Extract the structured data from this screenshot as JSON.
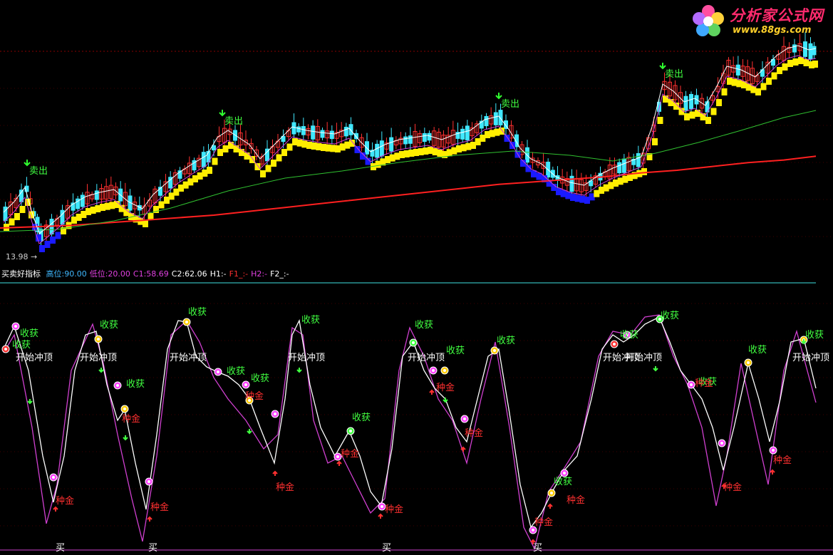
{
  "brand": {
    "title": "分析家公式网",
    "url": "www.88gs.com"
  },
  "price_panel": {
    "low_marker": "13.98",
    "sell_label": "卖出"
  },
  "indicator_bar": {
    "name": "买卖好指标",
    "items": [
      {
        "text": "高位:90.00",
        "color": "#3fb8ff"
      },
      {
        "text": "低位:20.00",
        "color": "#e040e0"
      },
      {
        "text": "C1:58.69",
        "color": "#e040e0"
      },
      {
        "text": "C2:62.06",
        "color": "#ffffff"
      },
      {
        "text": "H1:-",
        "color": "#ffffff"
      },
      {
        "text": "F1_:-",
        "color": "#ff3030"
      },
      {
        "text": "H2:-",
        "color": "#e040e0"
      },
      {
        "text": "F2_:-",
        "color": "#ffffff"
      }
    ]
  },
  "labels": {
    "harvest": "收获",
    "start_top": "开始冲顶",
    "plant_gold": "种金",
    "buy": "买"
  },
  "colors": {
    "ma_long": "#ff2020",
    "ma_mid": "#30c030",
    "ma_fast": "#d040d0",
    "ribbon_up": "#ffee00",
    "ribbon_down": "#1a1aff",
    "osc_fast": "#ffffff",
    "osc_slow": "#d040d0"
  },
  "chart_data": [
    {
      "type": "line",
      "title": "",
      "series": [
        {
          "name": "",
          "x": [
            0,
            50,
            100,
            150,
            200,
            250,
            300,
            350,
            400,
            450,
            500,
            550,
            600,
            650,
            700,
            750,
            800,
            850,
            900,
            950,
            1000,
            1050,
            1100,
            1145
          ],
          "values": [
            14.5,
            14.6,
            14.7,
            14.9,
            15.1,
            15.3,
            15.5,
            15.8,
            16.1,
            16.4,
            16.7,
            17.0,
            17.3,
            17.6,
            17.9,
            18.1,
            18.3,
            18.5,
            18.8,
            19.0,
            19.3,
            19.6,
            19.8,
            20.1
          ]
        }
      ],
      "markers": {
        "low": 13.98
      }
    },
    {
      "type": "line",
      "title": "",
      "ylim": [
        0,
        100
      ],
      "thresholds": {
        "high": 90.0,
        "low": 20.0
      },
      "current": {
        "C1": 58.69,
        "C2": 62.06
      }
    }
  ]
}
